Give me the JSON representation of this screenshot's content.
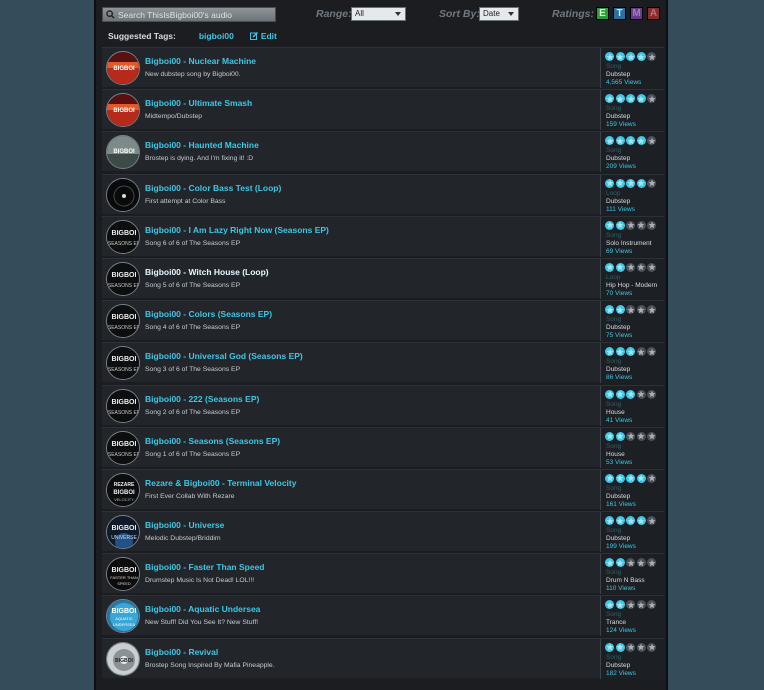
{
  "search": {
    "placeholder": "Search ThisIsBigboi00's audio"
  },
  "range": {
    "label": "Range:",
    "value": "All"
  },
  "sort": {
    "label": "Sort By:",
    "value": "Date"
  },
  "ratings": {
    "label": "Ratings:",
    "buttons": [
      {
        "letter": "E",
        "color": "#2f9a3a"
      },
      {
        "letter": "T",
        "color": "#2c6fa2"
      },
      {
        "letter": "M",
        "color": "#6a3a8c"
      },
      {
        "letter": "A",
        "color": "#8c2b2b"
      }
    ]
  },
  "tags": {
    "label": "Suggested Tags:",
    "tag": "bigboi00",
    "edit": "Edit"
  },
  "colors": {
    "accent": "#3cc7e6",
    "panel": "#1b1d21",
    "row": "#22262b",
    "background": "#354c5a"
  },
  "items": [
    {
      "title": "Bigboi00 - Nuclear Machine",
      "desc": "New dubstep song by Bigboi00.",
      "stars": 4,
      "type": "Song",
      "genre": "Dubstep",
      "views": "4,565 Views",
      "art": "red"
    },
    {
      "title": "Bigboi00 - Ultimate Smash",
      "desc": "Midtempo/Dubstep",
      "stars": 4,
      "type": "Song",
      "genre": "Dubstep",
      "views": "159 Views",
      "art": "red"
    },
    {
      "title": "Bigboi00 - Haunted Machine",
      "desc": "Brostep is dying. And I'm fixing it! :D",
      "stars": 4,
      "type": "Song",
      "genre": "Dubstep",
      "views": "209 Views",
      "art": "gray"
    },
    {
      "title": "Bigboi00 - Color Bass Test (Loop)",
      "desc": "First attempt at Color Bass",
      "stars": 4,
      "type": "Loop",
      "genre": "Dubstep",
      "views": "111 Views",
      "art": "dark"
    },
    {
      "title": "Bigboi00 - I Am Lazy Right Now (Seasons EP)",
      "desc": "Song 6 of 6 of The Seasons EP",
      "stars": 2,
      "type": "Song",
      "genre": "Solo Instrument",
      "views": "69 Views",
      "art": "seasons"
    },
    {
      "title": "Bigboi00 - Witch House (Loop)",
      "desc": "Song 5 of 6 of The Seasons EP",
      "stars": 2,
      "type": "Loop",
      "genre": "Hip Hop - Modern",
      "views": "70 Views",
      "art": "seasons"
    },
    {
      "title": "Bigboi00 - Colors (Seasons EP)",
      "desc": "Song 4 of 6 of The Seasons EP",
      "stars": 2,
      "type": "Song",
      "genre": "Dubstep",
      "views": "75 Views",
      "art": "seasons"
    },
    {
      "title": "Bigboi00 - Universal God (Seasons EP)",
      "desc": "Song 3 of 6 of The Seasons EP",
      "stars": 3,
      "type": "Song",
      "genre": "Dubstep",
      "views": "86 Views",
      "art": "seasons"
    },
    {
      "title": "Bigboi00 - 222 (Seasons EP)",
      "desc": "Song 2 of 6 of The Seasons EP",
      "stars": 3,
      "type": "Song",
      "genre": "House",
      "views": "41 Views",
      "art": "seasons"
    },
    {
      "title": "Bigboi00 - Seasons (Seasons EP)",
      "desc": "Song 1 of 6 of The Seasons EP",
      "stars": 2,
      "type": "Song",
      "genre": "House",
      "views": "53 Views",
      "art": "seasons"
    },
    {
      "title": "Rezare & Bigboi00 - Terminal Velocity",
      "desc": "First Ever Collab With Rezare",
      "stars": 4,
      "type": "Song",
      "genre": "Dubstep",
      "views": "161 Views",
      "art": "collab"
    },
    {
      "title": "Bigboi00 - Universe",
      "desc": "Melodic Dubstep/Briddim",
      "stars": 4,
      "type": "Song",
      "genre": "Dubstep",
      "views": "199 Views",
      "art": "universe"
    },
    {
      "title": "Bigboi00 - Faster Than Speed",
      "desc": "Drumstep Music Is Not Dead! LOL!!!",
      "stars": 2,
      "type": "Song",
      "genre": "Drum N Bass",
      "views": "110 Views",
      "art": "speed"
    },
    {
      "title": "Bigboi00 - Aquatic Undersea",
      "desc": "New Stuff! Did You See It? New Stuff!",
      "stars": 2,
      "type": "Song",
      "genre": "Trance",
      "views": "124 Views",
      "art": "aqua"
    },
    {
      "title": "Bigboi00 - Revival",
      "desc": "Brostep Song Inspired By Mafia Pineapple.",
      "stars": 2,
      "type": "Song",
      "genre": "Dubstep",
      "views": "182 Views",
      "art": "revival"
    }
  ]
}
